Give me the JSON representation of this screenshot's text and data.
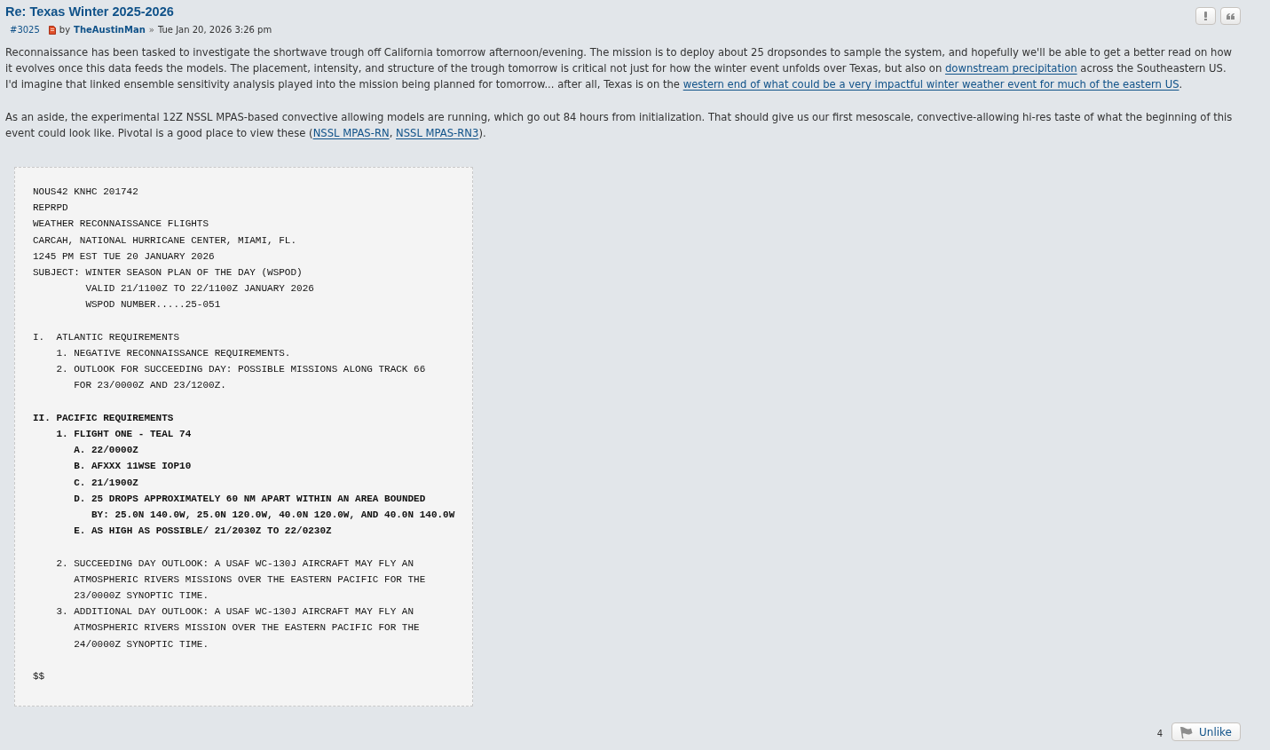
{
  "post": {
    "title": "Re: Texas Winter 2025-2026",
    "number": "#3025",
    "by": "by",
    "author": "TheAustinMan",
    "separator": "»",
    "date": "Tue Jan 20, 2026 3:26 pm"
  },
  "paragraphs": [
    {
      "parts": [
        {
          "kind": "text",
          "text": "Reconnaissance has been tasked to investigate the shortwave trough off California tomorrow afternoon/evening. The mission is to deploy about 25 dropsondes to sample the system, and hopefully we'll be able to get a better read on how it evolves once this data feeds the models. The placement, intensity, and structure of the trough tomorrow is critical not just for how the winter event unfolds over Texas, but also on "
        },
        {
          "kind": "link",
          "text": "downstream precipitation"
        },
        {
          "kind": "text",
          "text": " across the Southeastern US. I'd imagine that linked ensemble sensitivity analysis played into the mission being planned for tomorrow... after all, Texas is on the "
        },
        {
          "kind": "link",
          "text": "western end of what could be a very impactful winter weather event for much of the eastern US"
        },
        {
          "kind": "text",
          "text": "."
        }
      ]
    },
    {
      "parts": [
        {
          "kind": "text",
          "text": "As an aside, the experimental 12Z NSSL MPAS-based convective allowing models are running, which go out 84 hours from initialization. That should give us our first mesoscale, convective-allowing hi-res taste of what the beginning of this event could look like. Pivotal is a good place to view these ("
        },
        {
          "kind": "link",
          "text": "NSSL MPAS-RN"
        },
        {
          "kind": "text",
          "text": ", "
        },
        {
          "kind": "link",
          "text": "NSSL MPAS-RN3"
        },
        {
          "kind": "text",
          "text": ")."
        }
      ]
    }
  ],
  "code": "NOUS42 KNHC 201742\nREPRPD\nWEATHER RECONNAISSANCE FLIGHTS\nCARCAH, NATIONAL HURRICANE CENTER, MIAMI, FL.\n1245 PM EST TUE 20 JANUARY 2026\nSUBJECT: WINTER SEASON PLAN OF THE DAY (WSPOD)\n         VALID 21/1100Z TO 22/1100Z JANUARY 2026\n         WSPOD NUMBER.....25-051\n\nI.  ATLANTIC REQUIREMENTS\n    1. NEGATIVE RECONNAISSANCE REQUIREMENTS.\n    2. OUTLOOK FOR SUCCEEDING DAY: POSSIBLE MISSIONS ALONG TRACK 66\n       FOR 23/0000Z AND 23/1200Z.\n\n**II. PACIFIC REQUIREMENTS**\n    **1. FLIGHT ONE - TEAL 74**\n       **A. 22/0000Z**\n       **B. AFXXX 11WSE IOP10**\n       **C. 21/1900Z**\n       **D. 25 DROPS APPROXIMATELY 60 NM APART WITHIN AN AREA BOUNDED**\n          **BY: 25.0N 140.0W, 25.0N 120.0W, 40.0N 120.0W, AND 40.0N 140.0W**\n       **E. AS HIGH AS POSSIBLE/ 21/2030Z TO 22/0230Z**\n\n    2. SUCCEEDING DAY OUTLOOK: A USAF WC-130J AIRCRAFT MAY FLY AN\n       ATMOSPHERIC RIVERS MISSIONS OVER THE EASTERN PACIFIC FOR THE\n       23/0000Z SYNOPTIC TIME.\n    3. ADDITIONAL DAY OUTLOOK: A USAF WC-130J AIRCRAFT MAY FLY AN\n       ATMOSPHERIC RIVERS MISSION OVER THE EASTERN PACIFIC FOR THE\n       24/0000Z SYNOPTIC TIME.\n\n$$",
  "likes": {
    "count": "4",
    "button": "Unlike"
  }
}
